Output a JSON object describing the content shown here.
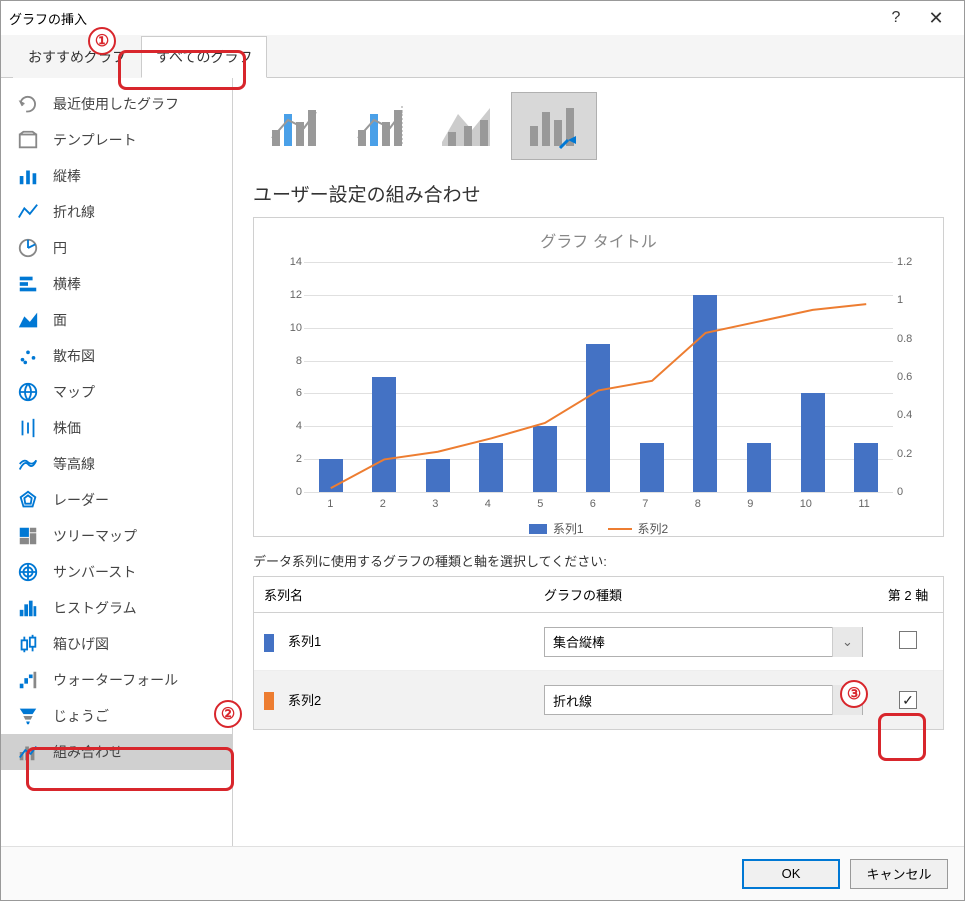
{
  "dialog": {
    "title": "グラフの挿入"
  },
  "tabs": {
    "recommended": "おすすめグラフ",
    "all": "すべてのグラフ"
  },
  "sidebar": {
    "items": [
      {
        "label": "最近使用したグラフ"
      },
      {
        "label": "テンプレート"
      },
      {
        "label": "縦棒"
      },
      {
        "label": "折れ線"
      },
      {
        "label": "円"
      },
      {
        "label": "横棒"
      },
      {
        "label": "面"
      },
      {
        "label": "散布図"
      },
      {
        "label": "マップ"
      },
      {
        "label": "株価"
      },
      {
        "label": "等高線"
      },
      {
        "label": "レーダー"
      },
      {
        "label": "ツリーマップ"
      },
      {
        "label": "サンバースト"
      },
      {
        "label": "ヒストグラム"
      },
      {
        "label": "箱ひげ図"
      },
      {
        "label": "ウォーターフォール"
      },
      {
        "label": "じょうご"
      },
      {
        "label": "組み合わせ"
      }
    ]
  },
  "main": {
    "heading": "ユーザー設定の組み合わせ",
    "preview_title": "グラフ タイトル",
    "series_instruction": "データ系列に使用するグラフの種類と軸を選択してください:",
    "table": {
      "col_name": "系列名",
      "col_type": "グラフの種類",
      "col_axis": "第 2 軸",
      "rows": [
        {
          "name": "系列1",
          "color": "#4472c4",
          "type": "集合縦棒",
          "axis2": false
        },
        {
          "name": "系列2",
          "color": "#ed7d31",
          "type": "折れ線",
          "axis2": true
        }
      ]
    },
    "legend": {
      "s1": "系列1",
      "s2": "系列2"
    }
  },
  "footer": {
    "ok": "OK",
    "cancel": "キャンセル"
  },
  "callouts": {
    "c1": "①",
    "c2": "②",
    "c3": "③"
  },
  "chart_data": {
    "type": "combo",
    "title": "グラフ タイトル",
    "categories": [
      "1",
      "2",
      "3",
      "4",
      "5",
      "6",
      "7",
      "8",
      "9",
      "10",
      "11"
    ],
    "series": [
      {
        "name": "系列1",
        "type": "bar",
        "axis": "left",
        "color": "#4472c4",
        "values": [
          2,
          7,
          2,
          3,
          4,
          9,
          3,
          12,
          3,
          6,
          3
        ]
      },
      {
        "name": "系列2",
        "type": "line",
        "axis": "right",
        "color": "#ed7d31",
        "values": [
          0.02,
          0.17,
          0.21,
          0.28,
          0.36,
          0.53,
          0.58,
          0.83,
          0.89,
          0.95,
          0.98
        ]
      }
    ],
    "y_left": {
      "min": 0,
      "max": 14,
      "step": 2
    },
    "y_right": {
      "min": 0,
      "max": 1.2,
      "step": 0.2
    }
  }
}
